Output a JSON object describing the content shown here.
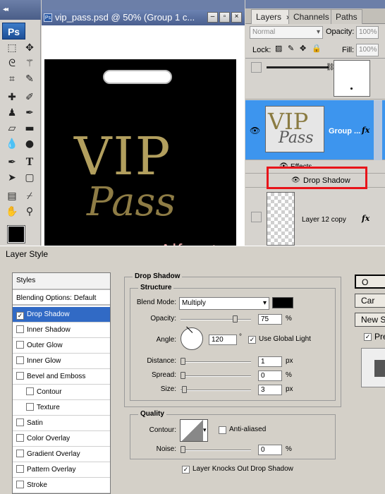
{
  "tools": {
    "logo": "Ps",
    "collapse": "◂◂"
  },
  "document": {
    "title": "vip_pass.psd @ 50% (Group 1 c...",
    "canvas_text_vip": "VIP",
    "canvas_text_pass": "Pass"
  },
  "layers_panel": {
    "tabs": [
      "Layers",
      "Channels",
      "Paths"
    ],
    "blend_mode": "Normal",
    "opacity_label": "Opacity:",
    "opacity_value": "100%",
    "lock_label": "Lock:",
    "fill_label": "Fill:",
    "fill_value": "100%",
    "rows": {
      "group_name": "Group ...",
      "effects": "Effects",
      "drop_shadow": "Drop Shadow",
      "layer12": "Layer 12 copy",
      "fx": "fx"
    },
    "highlight_color": "#e8141a"
  },
  "watermark": "Alfoart.com",
  "dialog": {
    "title": "Layer Style",
    "styles_header": "Styles",
    "styles": [
      {
        "label": "Blending Options: Default",
        "checkbox": false,
        "indent": false
      },
      {
        "label": "Drop Shadow",
        "checkbox": true,
        "checked": true,
        "selected": true
      },
      {
        "label": "Inner Shadow",
        "checkbox": true,
        "checked": false
      },
      {
        "label": "Outer Glow",
        "checkbox": true,
        "checked": false
      },
      {
        "label": "Inner Glow",
        "checkbox": true,
        "checked": false
      },
      {
        "label": "Bevel and Emboss",
        "checkbox": true,
        "checked": false
      },
      {
        "label": "Contour",
        "checkbox": true,
        "checked": false,
        "indent": true
      },
      {
        "label": "Texture",
        "checkbox": true,
        "checked": false,
        "indent": true
      },
      {
        "label": "Satin",
        "checkbox": true,
        "checked": false
      },
      {
        "label": "Color Overlay",
        "checkbox": true,
        "checked": false
      },
      {
        "label": "Gradient Overlay",
        "checkbox": true,
        "checked": false
      },
      {
        "label": "Pattern Overlay",
        "checkbox": true,
        "checked": false
      },
      {
        "label": "Stroke",
        "checkbox": true,
        "checked": false
      }
    ],
    "section": "Drop Shadow",
    "structure": "Structure",
    "blend_mode_label": "Blend Mode:",
    "blend_mode_value": "Multiply",
    "shadow_color": "#000000",
    "opacity_label": "Opacity:",
    "opacity_value": "75",
    "percent": "%",
    "angle_label": "Angle:",
    "angle_value": "120",
    "degree": "°",
    "global_light": "Use Global Light",
    "distance_label": "Distance:",
    "distance_value": "1",
    "spread_label": "Spread:",
    "spread_value": "0",
    "size_label": "Size:",
    "size_value": "3",
    "px": "px",
    "quality": "Quality",
    "contour_label": "Contour:",
    "anti_aliased": "Anti-aliased",
    "noise_label": "Noise:",
    "noise_value": "0",
    "knockout": "Layer Knocks Out Drop Shadow",
    "buttons": {
      "ok": "O",
      "cancel": "Car",
      "new_style": "New S",
      "preview": "Pre"
    }
  }
}
